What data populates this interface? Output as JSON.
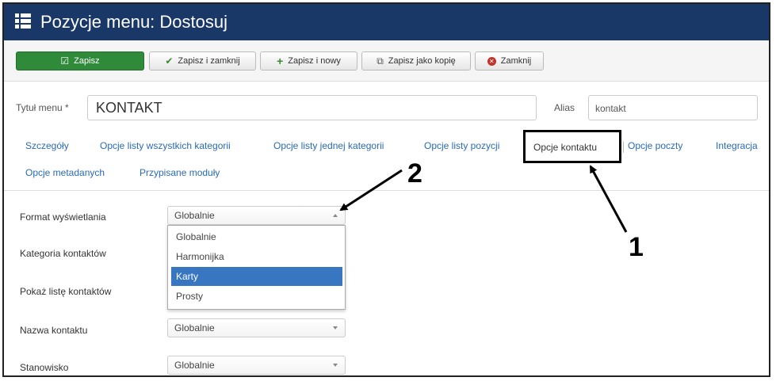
{
  "header": {
    "title": "Pozycje menu: Dostosuj",
    "icon": "list-icon"
  },
  "toolbar": {
    "save": "Zapisz",
    "save_close": "Zapisz i zamknij",
    "save_new": "Zapisz i nowy",
    "save_copy": "Zapisz jako kopię",
    "close": "Zamknij"
  },
  "form": {
    "title_label": "Tytuł menu *",
    "title_value": "KONTAKT",
    "alias_label": "Alias",
    "alias_value": "kontakt"
  },
  "tabs": [
    {
      "label": "Szczegóły"
    },
    {
      "label": "Opcje listy wszystkich kategorii"
    },
    {
      "label": "Opcje listy jednej kategorii"
    },
    {
      "label": "Opcje listy pozycji"
    },
    {
      "label": "Opcje kontaktu",
      "active": true
    },
    {
      "label": "Opcje poczty"
    },
    {
      "label": "Integracja"
    },
    {
      "label": "Opcje metadanych"
    },
    {
      "label": "Przypisane moduły"
    }
  ],
  "fields": [
    {
      "label": "Format wyświetlania",
      "value": "Globalnie",
      "open": true
    },
    {
      "label": "Kategoria kontaktów"
    },
    {
      "label": "Pokaż listę kontaktów"
    },
    {
      "label": "Nazwa kontaktu",
      "value": "Globalnie"
    },
    {
      "label": "Stanowisko",
      "value": "Globalnie"
    }
  ],
  "dropdown": {
    "options": [
      "Globalnie",
      "Harmonijka",
      "Karty",
      "Prosty"
    ],
    "highlighted": "Karty"
  },
  "annotations": {
    "one": "1",
    "two": "2"
  },
  "colors": {
    "header_bg": "#1a3867",
    "save_green": "#2f8a3a",
    "link_blue": "#2a6bb3",
    "highlight": "#3876c1"
  }
}
